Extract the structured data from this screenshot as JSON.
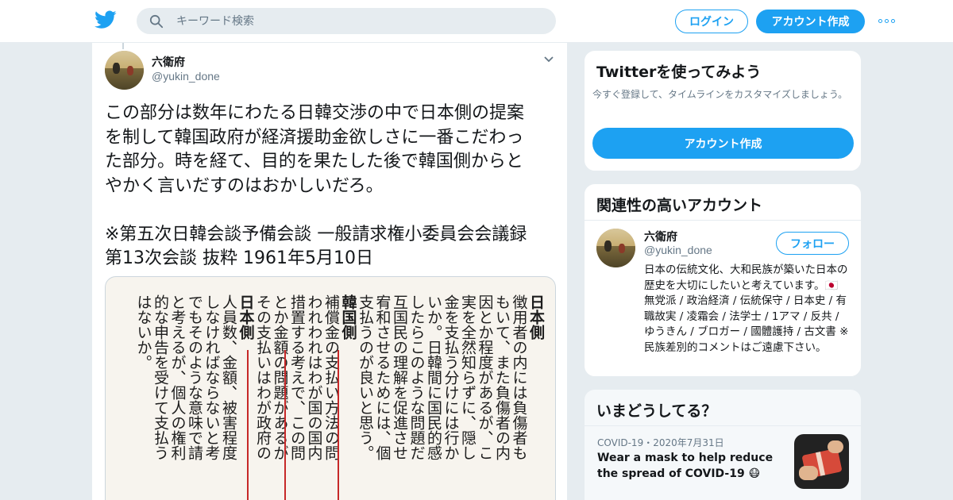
{
  "header": {
    "search_placeholder": "キーワード検索",
    "login_label": "ログイン",
    "signup_label": "アカウント作成",
    "brand_color": "#1da1f2"
  },
  "tweet": {
    "name": "六衛府",
    "handle": "@yukin_done",
    "text": "この部分は数年にわたる日韓交渉の中で日本側の提案\nを制して韓国政府が経済援助金欲しさに一番こだわっ\nた部分。時を経て、目的を果たした後で韓国側からと\nやかく言いだすのはおかしいだろ。\n\n※第五次日韓会談予備会談 一般請求権小委員会会議録\n第13次会談 抜粋 1961年5月10日",
    "image_columns": [
      "日本側",
      "徴用者の内には負傷者も",
      "もいて、また負傷者の内",
      "因とか程度があるが、こ",
      "実を全然知らずに、隠し",
      "金を支払う分けには行か",
      "いか。日韓間に国民的感",
      "したらこのような問題だ",
      "互国民の理解を促進させ",
      "宥和させるためには、個",
      "支払うのが良いと思う。",
      "韓国側",
      "補償金の支払い方法の問",
      "われわれはわが国の国内",
      "措置する考えで、この問",
      "とか金額の問題があるが",
      "その支払いはわが政府の",
      "日本側",
      "人員数、金額、被害程度",
      "しなければならないと考",
      "でもそのような意味で請",
      "と考えるが、個人の権利",
      "的な申告を受けて支払う",
      "はないか。"
    ]
  },
  "sidebar": {
    "try_title": "Twitterを使ってみよう",
    "try_desc": "今すぐ登録して、タイムラインをカスタマイズしましょう。",
    "try_button": "アカウント作成",
    "related_title": "関連性の高いアカウント",
    "related_account": {
      "name": "六衛府",
      "handle": "@yukin_done",
      "follow_label": "フォロー",
      "bio": "日本の伝統文化、大和民族が築いた日本の歴史を大切にしたいと考えています。🇯🇵 無党派 / 政治経済 / 伝統保守 / 日本史 / 有職故実 / 凌霜会 / 法学士 / 1アマ / 反共 / ゆうきん / ブロガー / 國體護持 / 古文書 ※民族差別的コメントはご遠慮下さい。"
    },
    "trends_title": "いまどうしてる？",
    "trend": {
      "meta": "COVID-19・2020年7月31日",
      "text": "Wear a mask to help reduce the spread of COVID-19 😷"
    }
  }
}
